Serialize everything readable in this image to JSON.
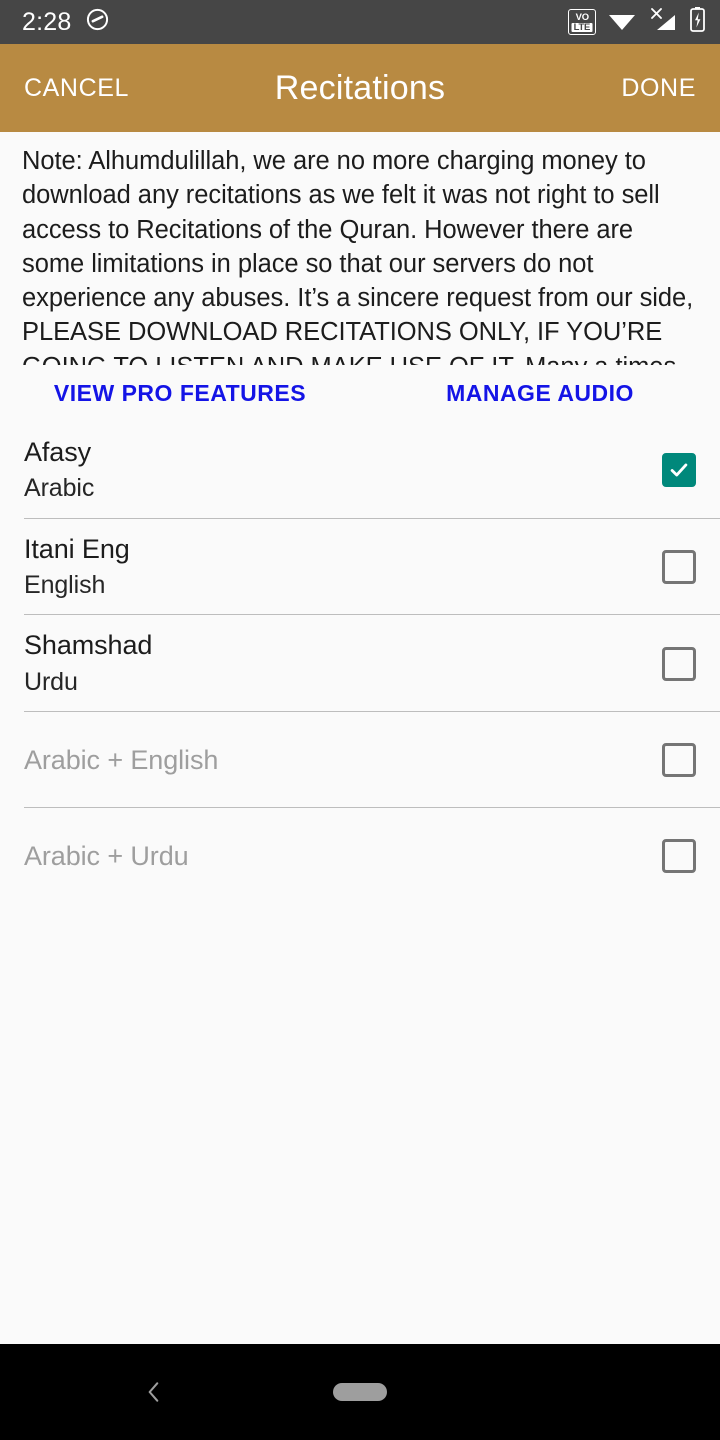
{
  "status_bar": {
    "clock": "2:28",
    "dnd_icon": "do-not-disturb-icon",
    "volte_top": "VO",
    "volte_bottom": "LTE",
    "wifi_icon": "wifi-icon",
    "signal_icon": "cellular-signal-no-service-icon",
    "battery_icon": "battery-charging-icon",
    "background": "#464646"
  },
  "app_bar": {
    "cancel_label": "CANCEL",
    "title": "Recitations",
    "done_label": "DONE",
    "background": "#b88a42",
    "text_color": "#ffffff"
  },
  "note": {
    "text": "Note: Alhumdulillah, we are no more charging money to download any recitations as we felt it was not right to sell access to Recitations of the Quran. However there are some limitations in place so that our servers do not experience any abuses. It’s a sincere request from our side, PLEASE DOWNLOAD RECITATIONS ONLY, IF YOU’RE GOING TO LISTEN AND MAKE USE OF IT. Many a times people might download audio’s of big Surah’s and never to listen it ever again. If"
  },
  "actions": {
    "view_pro_features": "VIEW PRO FEATURES",
    "manage_audio": "MANAGE AUDIO",
    "link_color": "#1414e6"
  },
  "recitations": {
    "checked_color": "#00887b",
    "unchecked_border": "#757575",
    "items": [
      {
        "title": "Afasy",
        "subtitle": "Arabic",
        "checked": true,
        "enabled": true
      },
      {
        "title": "Itani Eng",
        "subtitle": "English",
        "checked": false,
        "enabled": true
      },
      {
        "title": "Shamshad",
        "subtitle": "Urdu",
        "checked": false,
        "enabled": true
      },
      {
        "title": "Arabic + English",
        "subtitle": "",
        "checked": false,
        "enabled": false
      },
      {
        "title": "Arabic + Urdu",
        "subtitle": "",
        "checked": false,
        "enabled": false
      }
    ]
  },
  "nav_bar": {
    "back_icon": "chevron-left-icon",
    "home_pill_icon": "home-pill-icon",
    "background": "#000000"
  }
}
